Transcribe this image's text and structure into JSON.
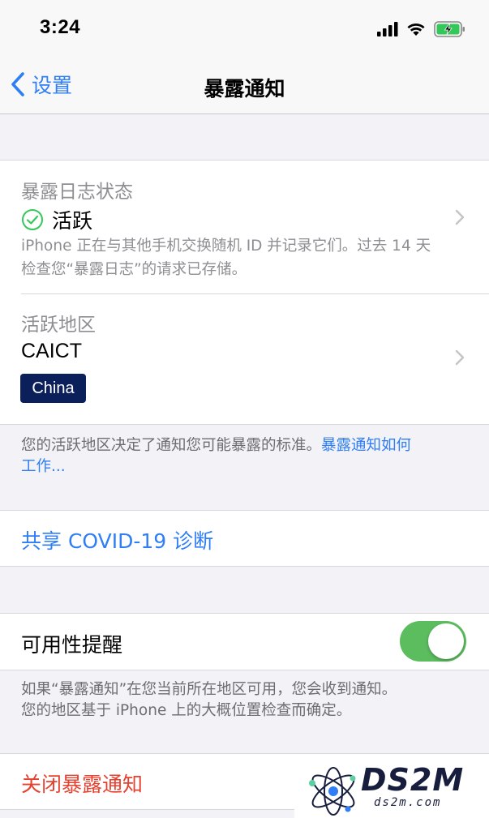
{
  "status_bar": {
    "time": "3:24",
    "icons": [
      "cellular-signal-icon",
      "wifi-icon",
      "battery-charging-icon"
    ]
  },
  "nav": {
    "back_label": "设置",
    "title": "暴露通知"
  },
  "exposure_log": {
    "section_label": "暴露日志状态",
    "status": "活跃",
    "status_icon": "check-circle-icon",
    "status_color": "#34c759",
    "description_line1": "iPhone 正在与其他手机交换随机 ID 并记录它们。过去 14 天",
    "description_line2": "检查您“暴露日志”的请求已存储。"
  },
  "active_region": {
    "section_label": "活跃地区",
    "region_name": "CAICT",
    "badge": "China",
    "badge_color": "#0b1f5b"
  },
  "region_note": {
    "text": "您的活跃地区决定了通知您可能暴露的标准。",
    "link_part1": "暴露通知如何",
    "link_part2": "工作..."
  },
  "share_diagnosis": {
    "label": "共享 COVID-19 诊断"
  },
  "availability": {
    "label": "可用性提醒",
    "toggle_on": true,
    "toggle_color": "#5cbd5f"
  },
  "availability_note": {
    "line1": "如果“暴露通知”在您当前所在地区可用，您会收到通知。",
    "line2": "您的地区基于 iPhone 上的大概位置检查而确定。"
  },
  "turn_off": {
    "label": "关闭暴露通知"
  },
  "watermark": {
    "title": "DS2M",
    "subtitle": "ds2m.com"
  },
  "colors": {
    "accent": "#2f7ef5",
    "destructive": "#e8402f",
    "background": "#f2f2f7"
  }
}
